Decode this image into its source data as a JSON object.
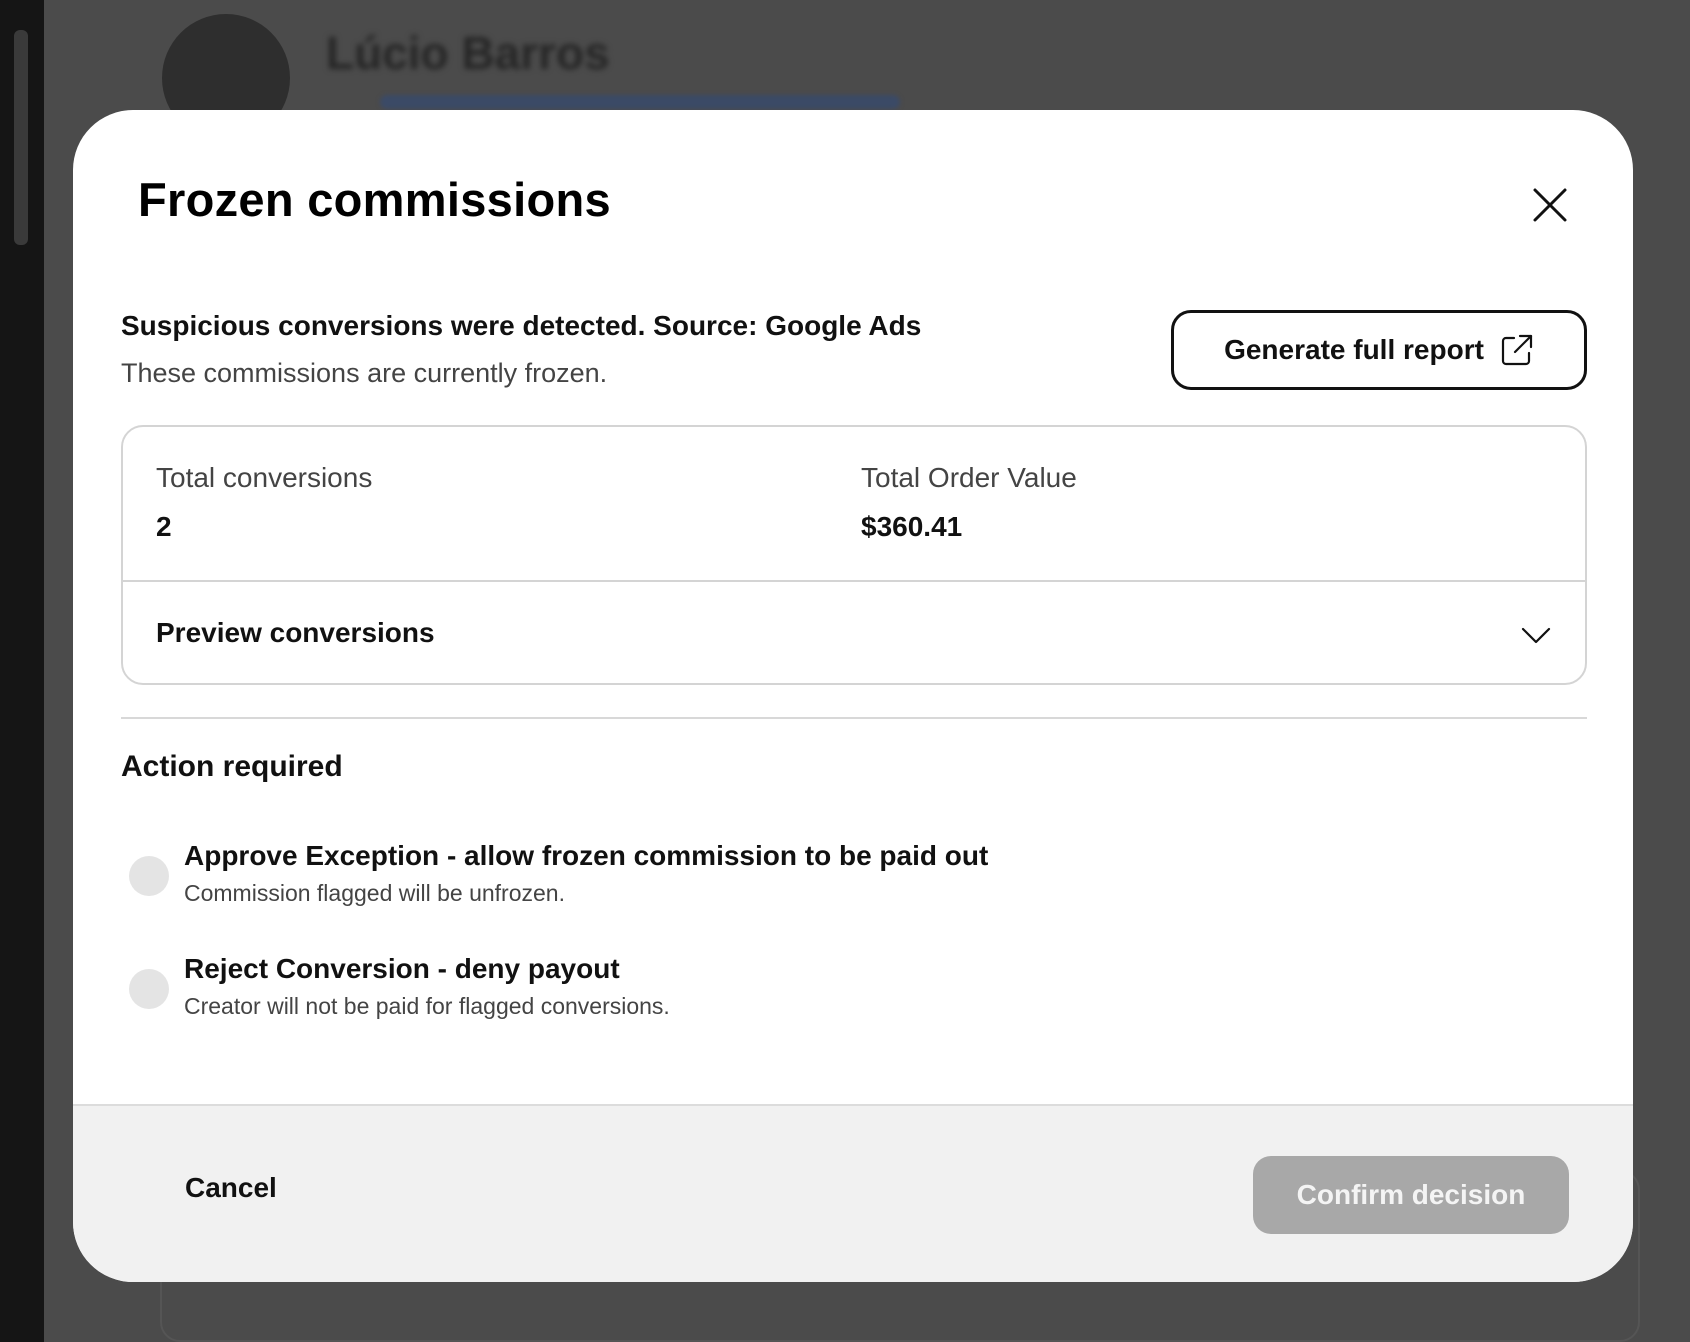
{
  "background": {
    "creator_name": "Lúcio Barros"
  },
  "modal": {
    "title": "Frozen commissions",
    "alert": {
      "title": "Suspicious conversions were detected. Source: Google Ads",
      "subtitle": "These commissions are currently frozen."
    },
    "report_button_label": "Generate full report",
    "stats": {
      "total_conversions_label": "Total conversions",
      "total_conversions_value": "2",
      "total_order_value_label": "Total Order Value",
      "total_order_value_value": "$360.41"
    },
    "preview_label": "Preview conversions",
    "action_title": "Action required",
    "options": [
      {
        "title": "Approve Exception - allow frozen commission to be paid out",
        "description": "Commission flagged will be unfrozen."
      },
      {
        "title": "Reject Conversion - deny payout",
        "description": "Creator will not be paid for flagged conversions."
      }
    ],
    "footer": {
      "cancel_label": "Cancel",
      "confirm_label": "Confirm decision"
    }
  },
  "icons": {
    "close": "close-icon",
    "external_link": "external-link-icon",
    "chevron": "chevron-down-icon"
  },
  "colors": {
    "confirm_disabled": "#a8a8a8",
    "radio_unselected": "#e4e4e4",
    "footer_background": "#f1f1f1"
  }
}
